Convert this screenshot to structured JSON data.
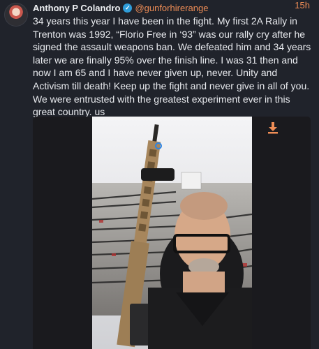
{
  "post": {
    "author_name": "Anthony P Colandro",
    "author_handle": "@gunforhirerange",
    "verified_glyph": "✓",
    "timestamp": "15h",
    "body": "34 years this year I have been in the fight. My first 2A Rally in Trenton was 1992, “Florio Free in ‘93” was our rally cry after he signed the assault weapons ban. We defeated him and 34 years later we are finally 95% over the finish line. I was 31 then and now I am 65 and I have never given up, never. Unity and Activism till death! Keep up the fight and never give in all of you. We were entrusted with the greatest experiment ever in this great country. us"
  },
  "media": {
    "type": "video",
    "download_icon": "download-icon"
  },
  "colors": {
    "background": "#20232b",
    "accent": "#ef8d56",
    "verified": "#2f9dd9"
  }
}
